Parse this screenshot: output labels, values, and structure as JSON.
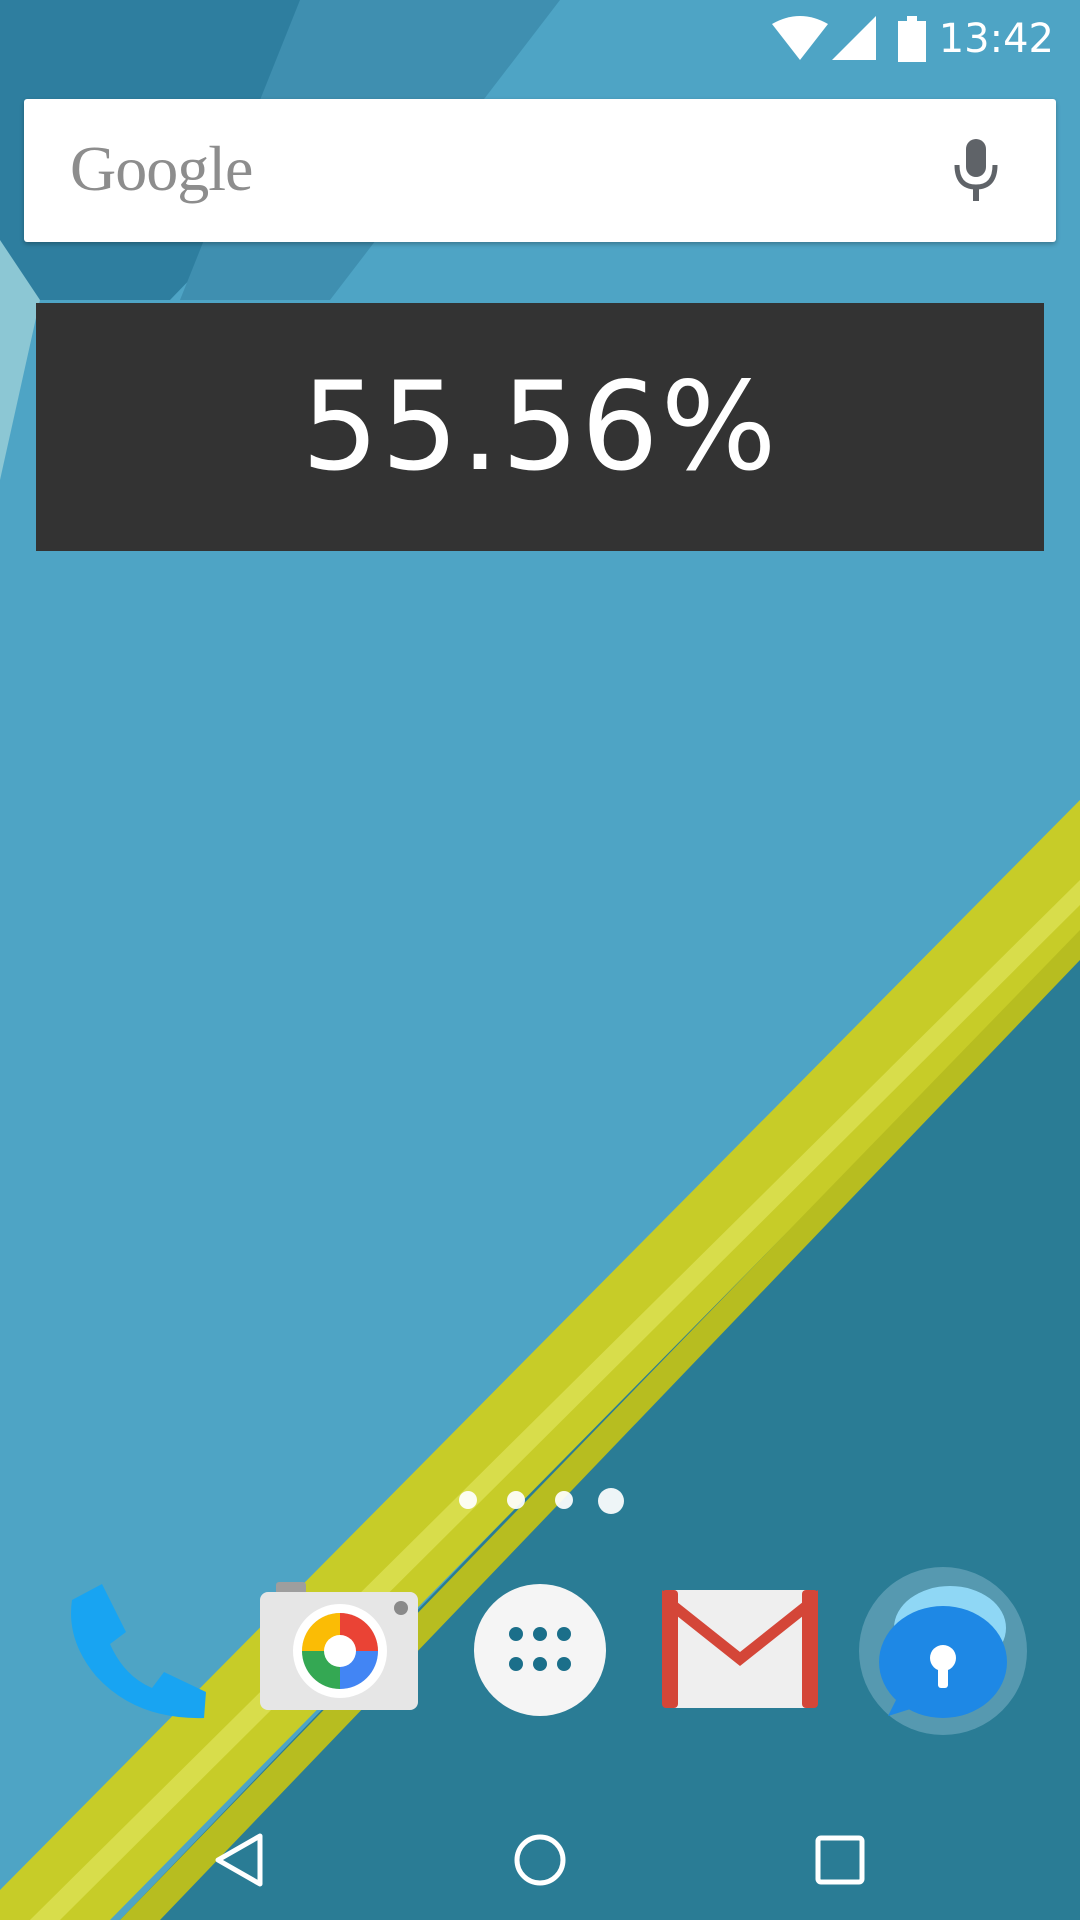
{
  "status_bar": {
    "time": "13:42",
    "icons": [
      "wifi-icon",
      "cell-signal-icon",
      "battery-icon"
    ]
  },
  "search_bar": {
    "logo_text": "Google",
    "mic_icon": "microphone-icon"
  },
  "battery_widget": {
    "value": "55.56%"
  },
  "home_pages": {
    "count": 4,
    "current_index": 3
  },
  "dock": {
    "apps": [
      {
        "name": "Phone",
        "icon": "phone-icon"
      },
      {
        "name": "Camera",
        "icon": "camera-icon"
      },
      {
        "name": "All apps",
        "icon": "app-drawer-icon"
      },
      {
        "name": "Gmail",
        "icon": "gmail-icon"
      },
      {
        "name": "Lock app",
        "icon": "lock-chat-icon"
      }
    ]
  },
  "nav_bar": {
    "buttons": [
      "back-icon",
      "home-icon",
      "recents-icon"
    ]
  },
  "colors": {
    "wallpaper_blue": "#4da3c4",
    "wallpaper_dark": "#1c6a82",
    "wallpaper_stripe": "#c9cf2a",
    "widget_bg": "#333333"
  }
}
